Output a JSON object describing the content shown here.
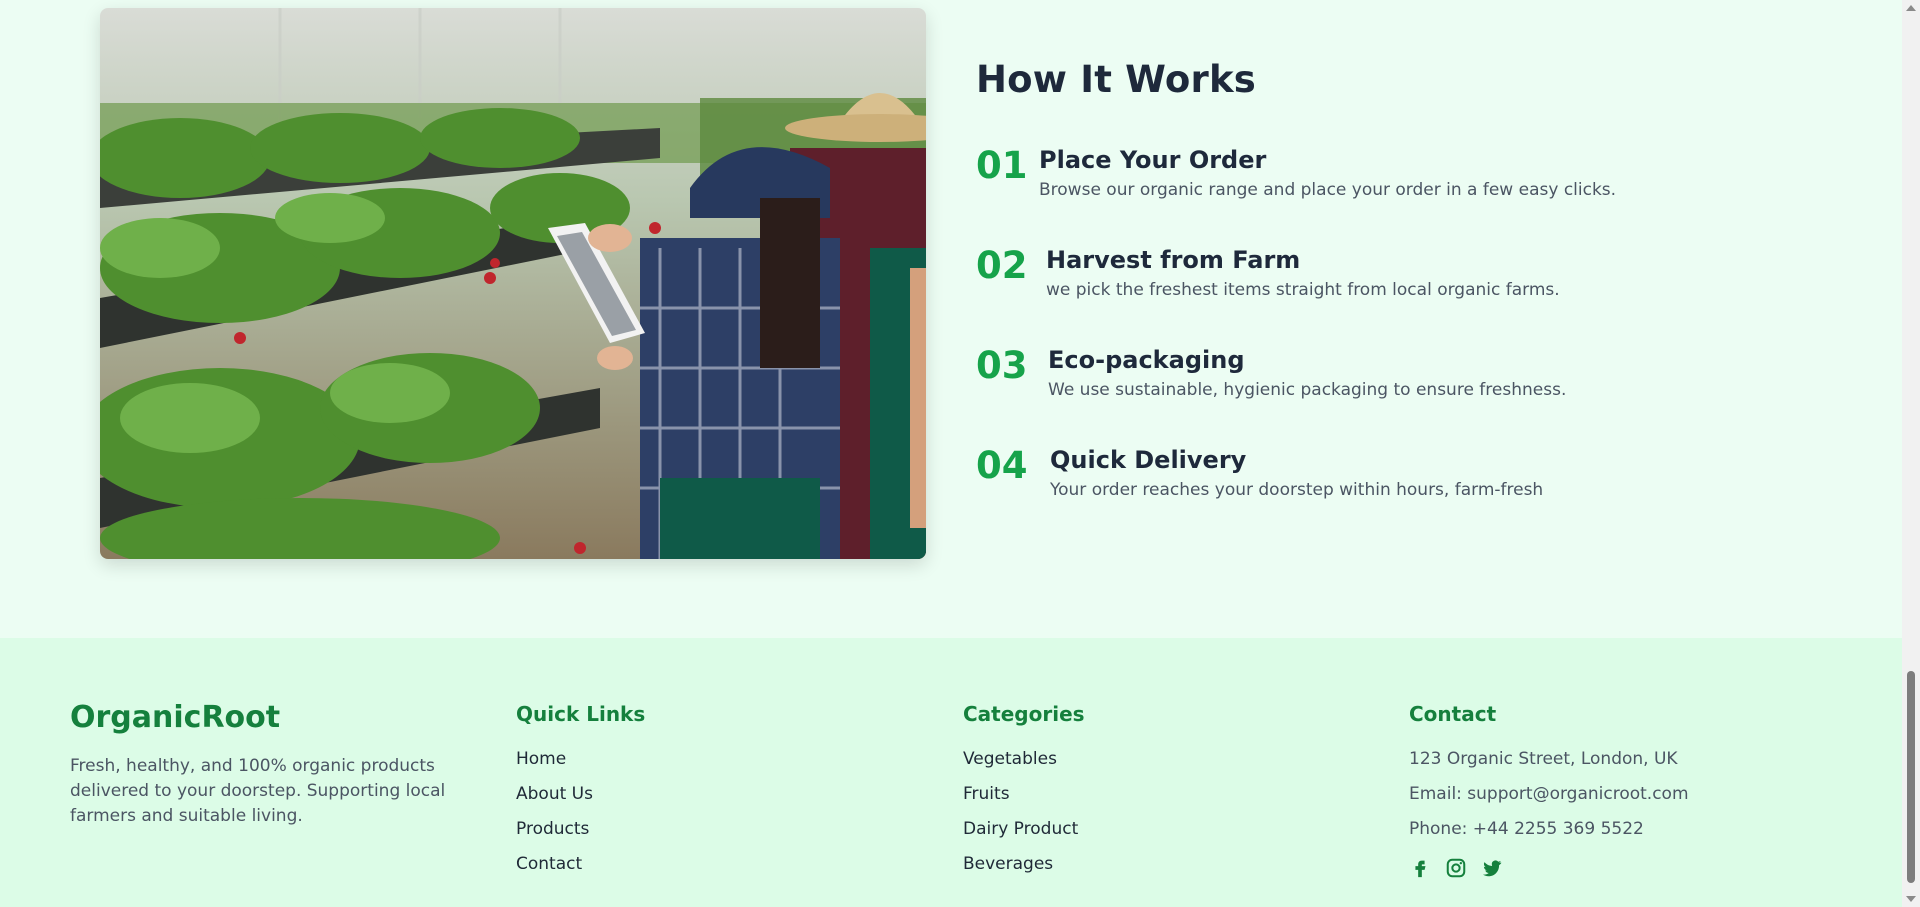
{
  "how_it_works": {
    "title": "How It Works",
    "steps": [
      {
        "num": "01",
        "title": "Place Your Order",
        "desc": "Browse our organic range and place your order in a few easy clicks."
      },
      {
        "num": "02",
        "title": "Harvest from Farm",
        "desc": "we pick the freshest items straight from local organic farms."
      },
      {
        "num": "03",
        "title": "Eco-packaging",
        "desc": "We use sustainable, hygienic packaging to ensure freshness."
      },
      {
        "num": "04",
        "title": "Quick Delivery",
        "desc": "Your order reaches your doorstep within hours, farm-fresh"
      }
    ]
  },
  "footer": {
    "brand": "OrganicRoot",
    "brand_desc": "Fresh, healthy, and 100% organic products delivered to your doorstep. Supporting local farmers and suitable living.",
    "quick_links": {
      "title": "Quick Links",
      "items": [
        "Home",
        "About Us",
        "Products",
        "Contact"
      ]
    },
    "categories": {
      "title": "Categories",
      "items": [
        "Vegetables",
        "Fruits",
        "Dairy Product",
        "Beverages"
      ]
    },
    "contact": {
      "title": "Contact",
      "address": "123 Organic Street, London, UK",
      "email": "Email: support@organicroot.com",
      "phone": "Phone: +44 2255 369 5522",
      "socials": [
        "facebook-icon",
        "instagram-icon",
        "twitter-icon"
      ]
    }
  },
  "colors": {
    "accent": "#16a34a",
    "brand": "#15803d",
    "section_bg": "#ecfdf3",
    "footer_bg": "#dcfce7",
    "heading": "#1e293b"
  }
}
